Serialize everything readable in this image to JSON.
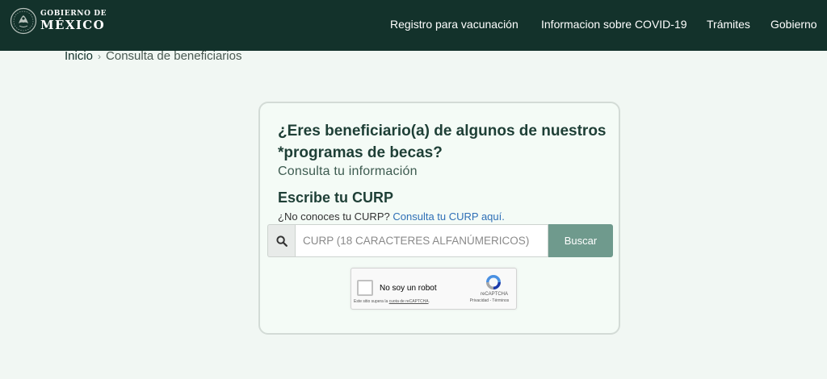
{
  "header": {
    "logo": {
      "line1": "GOBIERNO DE",
      "line2": "MÉXICO"
    },
    "nav": [
      "Registro para vacunación",
      "Informacion sobre COVID-19",
      "Trámites",
      "Gobierno"
    ]
  },
  "breadcrumb": {
    "home": "Inicio",
    "separator": "›",
    "current": "Consulta de beneficiarios"
  },
  "card": {
    "question": "¿Eres beneficiario(a) de algunos de nuestros *programas de becas?",
    "subtitle": "Consulta tu información",
    "curp_heading": "Escribe tu CURP",
    "curp_help_text": "¿No conoces tu CURP?",
    "curp_help_link": "Consulta tu CURP aquí.",
    "search": {
      "icon": "search-icon",
      "placeholder": "CURP (18 CARACTERES ALFANÚMERICOS)",
      "value": "",
      "button_label": "Buscar"
    },
    "recaptcha": {
      "checkbox_label": "No soy un robot",
      "brand": "reCAPTCHA",
      "terms": "Privacidad - Términos",
      "quota_prefix": "Este sitio supera la",
      "quota_link": "cuota de reCAPTCHA",
      "quota_suffix": "."
    }
  },
  "colors": {
    "header_bg": "#13322b",
    "page_bg": "#f1f7f3",
    "button_bg": "#6f9a8d",
    "link": "#2e6fb6",
    "heading": "#1e3f36"
  }
}
